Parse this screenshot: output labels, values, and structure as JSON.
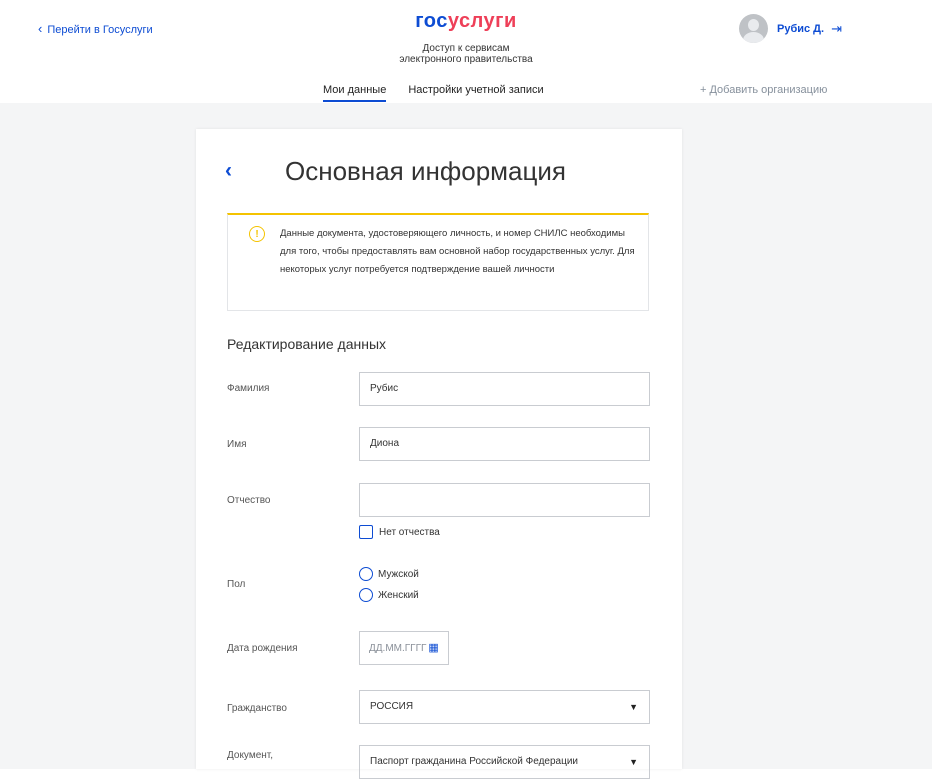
{
  "header": {
    "back_link": "Перейти в Госуслуги",
    "logo_part1": "гос",
    "logo_part2": "услуги",
    "tagline_line1": "Доступ к сервисам",
    "tagline_line2": "электронного правительства",
    "user_name": "Рубис Д."
  },
  "tabs": [
    {
      "label": "Мои данные",
      "active": true
    },
    {
      "label": "Настройки учетной записи",
      "active": false
    }
  ],
  "add_org": "+ Добавить организацию",
  "page": {
    "title": "Основная информация",
    "notice_text": "Данные документа, удостоверяющего личность, и номер СНИЛС необходимы для того, чтобы предоставлять вам основной набор государственных услуг. Для некоторых услуг потребуется подтверждение вашей личности",
    "section_title": "Редактирование данных"
  },
  "form": {
    "surname": {
      "label": "Фамилия",
      "value": "Рубис"
    },
    "name": {
      "label": "Имя",
      "value": "Диона"
    },
    "patronymic": {
      "label": "Отчество",
      "value": ""
    },
    "no_patronymic_label": "Нет отчества",
    "gender": {
      "label": "Пол",
      "options": [
        "Мужской",
        "Женский"
      ]
    },
    "birth_date": {
      "label": "Дата рождения",
      "placeholder": "ДД.ММ.ГГГГ"
    },
    "citizenship": {
      "label": "Гражданство",
      "value": "РОССИЯ"
    },
    "document": {
      "label": "Документ,",
      "value": "Паспорт гражданина Российской Федерации"
    }
  },
  "colors": {
    "accent": "#0d4cd3",
    "logo_red": "#ee3f58",
    "warning": "#f4c300"
  },
  "icons": [
    "chevron-left-icon",
    "avatar",
    "logout-icon",
    "warning-icon",
    "calendar-icon",
    "dropdown-arrow-icon"
  ]
}
